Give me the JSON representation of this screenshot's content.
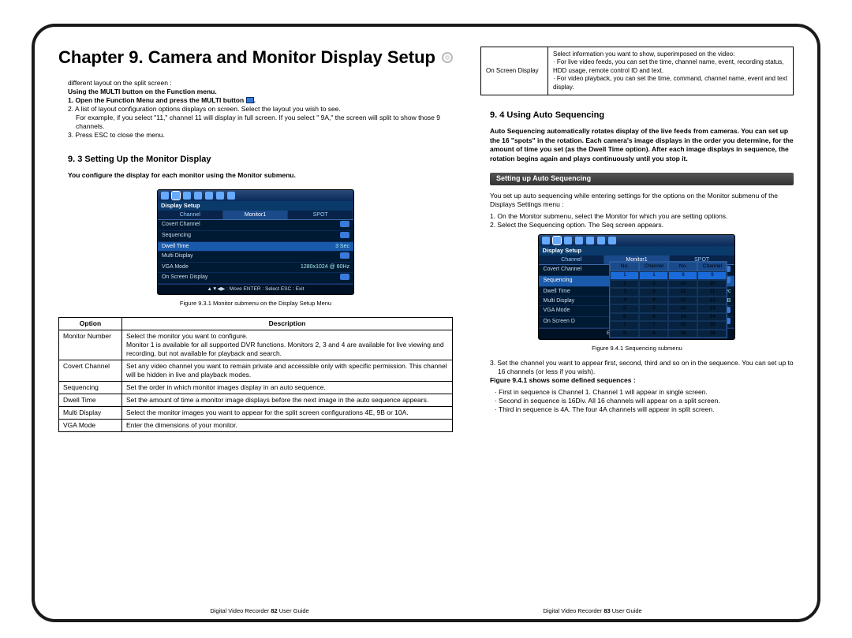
{
  "chapter_title": "Chapter 9. Camera and Monitor Display Setup",
  "left": {
    "intro_line1": "different layout on the split screen :",
    "intro_line2": "Using the MULTI button on the Function menu.",
    "intro_item1_a": "1. Open the Function Menu and press the MULTI button ",
    "intro_item1_b": ".",
    "intro_item2": "2. A list of layout configuration options displays on screen. Select the layout you wish to see.",
    "intro_item2_sub": "For example, if you select \"11,\" channel 11 will display in full screen. If you select \" 9A,\" the screen will split to show those 9 channels.",
    "intro_item3": "3. Press ESC to close the menu.",
    "section_9_3": "9. 3 Setting Up the Monitor Display",
    "config_line": "You configure the display for each monitor using the Monitor submenu.",
    "fig_9_3_1": "Figure 9.3.1 Monitor submenu on the Display Setup Menu",
    "table_headers": {
      "opt": "Option",
      "desc": "Description"
    },
    "table_rows": [
      {
        "opt": "Monitor Number",
        "desc": "Select the monitor you want to configure.\nMonitor 1 is available for all supported DVR functions. Monitors 2, 3 and 4 are available for live viewing and recording, but not available for playback and search."
      },
      {
        "opt": "Covert Channel",
        "desc": "Set any video channel you want to remain private and accessible only with specific permission. This channel will be hidden in live and playback modes."
      },
      {
        "opt": "Sequencing",
        "desc": "Set the order in which monitor images display in an auto sequence."
      },
      {
        "opt": "Dwell Time",
        "desc": "Set the amount of time a monitor image displays before the next image in the auto sequence appears."
      },
      {
        "opt": "Multi Display",
        "desc": "Select the monitor images you want to appear for the split screen configurations 4E, 9B or 10A."
      },
      {
        "opt": "VGA Mode",
        "desc": "Enter the dimensions of your monitor."
      }
    ],
    "dvr1": {
      "title": "Display Setup",
      "tabs": [
        "Channel",
        "Monitor1",
        "SPOT"
      ],
      "rows": [
        {
          "label": "Covert Channel",
          "val": ""
        },
        {
          "label": "Sequencing",
          "val": ""
        },
        {
          "label": "Dwell Time",
          "val": "3 Sec",
          "hl": true
        },
        {
          "label": "Multi Display",
          "val": ""
        },
        {
          "label": "VGA Mode",
          "val": "1280x1024 @ 60Hz"
        },
        {
          "label": "On Screen Display",
          "val": ""
        }
      ],
      "footer": "▲▼◀▶ : Move      ENTER : Select      ESC : Exit"
    }
  },
  "right": {
    "osd_label": "On Screen Display",
    "osd_text": "Select information you want to show, superimposed on the video:\n· For live video feeds, you can set the time, channel name, event, recording status, HDD usage, remote control ID and text.\n· For video playback, you can set the time, command, channel name, event and text display.",
    "section_9_4": "9. 4 Using Auto Sequencing",
    "auto_seq_intro": "Auto Sequencing automatically rotates display of the live feeds from cameras. You can set up the 16 \"spots\" in the rotation. Each camera's image displays in the order you determine, for the amount of time you set (as the Dwell Time option). After each image displays in sequence, the rotation begins again and plays continuously until you stop it.",
    "sub_setting_up": "Setting up Auto Sequencing",
    "setup_line1": "You set up auto sequencing while entering settings for the options on the Monitor submenu of the Displays Settings menu :",
    "setup_item1": "1. On the Monitor submenu, select the Monitor for which you are setting options.",
    "setup_item2": "2. Select the Sequencing option. The Seq screen appears.",
    "fig_9_4_1": "Figure 9.4.1 Sequencing submenu",
    "setup_item3": "3. Set the channel you want to appear first, second, third and so on in the sequence. You can set up to 16 channels (or less if you wish).",
    "seq_line": "Figure 9.4.1 shows some defined sequences :",
    "seq_b1": "· First in sequence is Channel 1. Channel 1 will appear in single screen.",
    "seq_b2": "· Second in sequence is 16Div. All 16 channels will appear on a split screen.",
    "seq_b3": "· Third in sequence is 4A. The four 4A channels will appear in split screen.",
    "dvr2": {
      "title": "Display Setup",
      "tabs": [
        "Channel",
        "Monitor1",
        "SPOT"
      ],
      "rows": [
        {
          "label": "Covert Channel",
          "val": ""
        },
        {
          "label": "Sequencing",
          "val": "",
          "hl": true
        },
        {
          "label": "Dwell Time",
          "val": "3 Sec"
        },
        {
          "label": "Multi Display",
          "val": "4E 9B"
        },
        {
          "label": "VGA Mode",
          "val": ""
        },
        {
          "label": "On Screen D",
          "val": ""
        }
      ],
      "footer": "ENTER : Select      ESC : Exit",
      "popup_headers": [
        "No.",
        "Channel",
        "No.",
        "Channel"
      ],
      "popup_rows": [
        [
          "1",
          "1",
          "9",
          "9"
        ],
        [
          "2",
          "2",
          "10",
          "10"
        ],
        [
          "3",
          "3",
          "11",
          "11"
        ],
        [
          "4",
          "4",
          "12",
          "12"
        ],
        [
          "5",
          "5",
          "13",
          "13"
        ],
        [
          "6",
          "6",
          "14",
          "14"
        ],
        [
          "7",
          "7",
          "15",
          "15"
        ],
        [
          "8",
          "8",
          "16",
          "16"
        ]
      ]
    }
  },
  "footer": {
    "left_pre": "Digital Video Recorder ",
    "left_pg": "82",
    "left_post": " User Guide",
    "right_pre": "Digital Video Recorder ",
    "right_pg": "83",
    "right_post": " User Guide"
  }
}
